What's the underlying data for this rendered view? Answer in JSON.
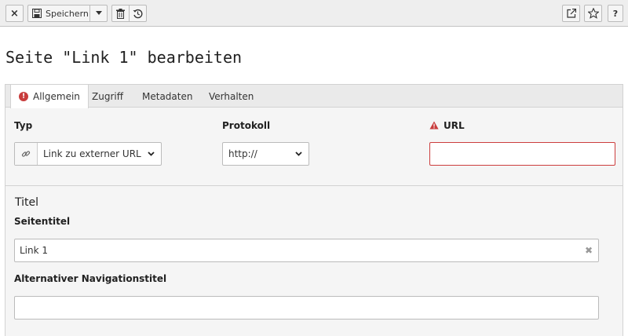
{
  "toolbar": {
    "close_symbol": "×",
    "save_label": "Speichern",
    "icons": [
      "save-icon",
      "caret-down-icon",
      "trash-icon",
      "history-icon",
      "open-external-icon",
      "star-icon",
      "help-icon"
    ],
    "help_symbol": "?"
  },
  "page": {
    "title": "Seite \"Link 1\" bearbeiten"
  },
  "tabs": [
    {
      "label": "Allgemein",
      "active": true,
      "has_error": true
    },
    {
      "label": "Zugriff",
      "active": false
    },
    {
      "label": "Metadaten",
      "active": false
    },
    {
      "label": "Verhalten",
      "active": false
    }
  ],
  "fields": {
    "typ": {
      "label": "Typ",
      "value": "Link zu externer URL"
    },
    "protokoll": {
      "label": "Protokoll",
      "value": "http://"
    },
    "url": {
      "label": "URL",
      "value": "",
      "has_error": true
    }
  },
  "title_section": {
    "heading": "Titel",
    "seitentitel": {
      "label": "Seitentitel",
      "value": "Link 1"
    },
    "nav_title": {
      "label": "Alternativer Navigationstitel",
      "value": ""
    }
  },
  "colors": {
    "error": "#c83c3c",
    "toolbar_bg": "#eeeeee",
    "panel_bg": "#f5f5f5"
  }
}
